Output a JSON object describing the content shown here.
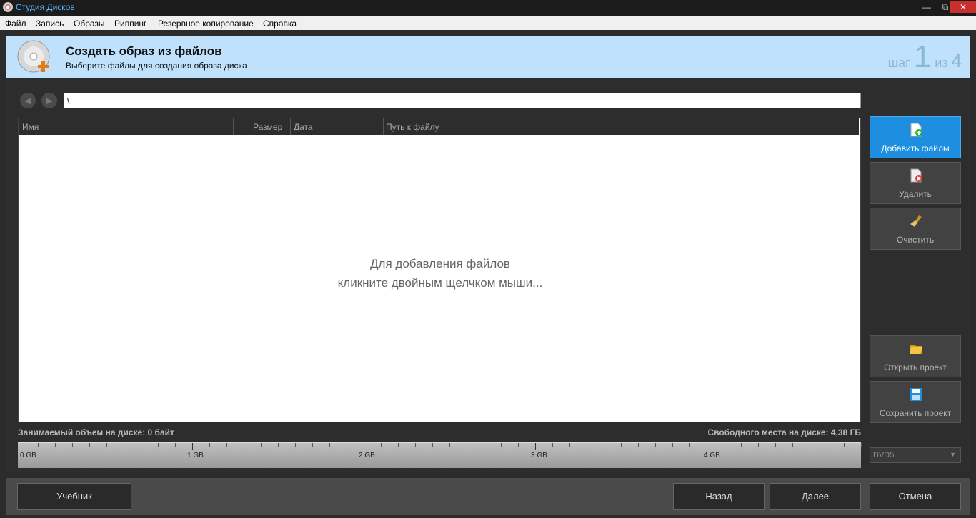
{
  "window": {
    "title": "Студия Дисков",
    "controls": [
      "—",
      "⧉",
      "✕"
    ]
  },
  "menu": [
    "Файл",
    "Запись",
    "Образы",
    "Риппинг",
    "Резервное копирование",
    "Справка"
  ],
  "header": {
    "title": "Создать образ из файлов",
    "subtitle": "Выберите файлы для создания образа диска",
    "step_word": "шаг",
    "step_current": "1",
    "step_of": "из",
    "step_total": "4"
  },
  "path": "\\",
  "nav": {
    "back_icon": "arrow-left-icon",
    "forward_icon": "arrow-right-icon"
  },
  "table": {
    "columns": [
      "Имя",
      "Размер",
      "Дата",
      "Путь к файлу"
    ],
    "empty_line1": "Для добавления файлов",
    "empty_line2": "кликните двойным щелчком мыши..."
  },
  "side": {
    "add": "Добавить файлы",
    "delete": "Удалить",
    "clear": "Очистить",
    "open": "Открыть проект",
    "save": "Сохранить проект"
  },
  "disk": {
    "used": "Занимаемый объем на диске: 0 байт",
    "free": "Свободного места на диске: 4,38 ГБ",
    "scale_labels": [
      "0 GB",
      "1 GB",
      "2 GB",
      "3 GB",
      "4 GB"
    ],
    "type": "DVD5"
  },
  "footer": {
    "tutorial": "Учебник",
    "back": "Назад",
    "next": "Далее",
    "cancel": "Отмена"
  },
  "colors": {
    "accent": "#1e8fe0",
    "header_bg": "#bfe1fb",
    "title_text": "#58b6ff"
  }
}
